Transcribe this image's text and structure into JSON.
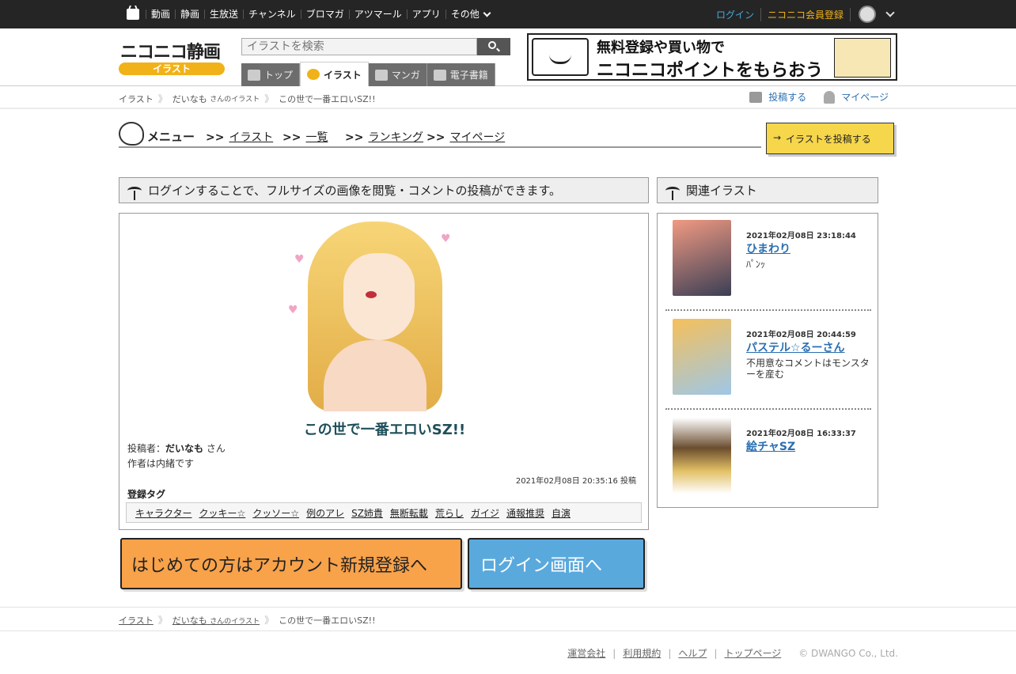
{
  "topbar": {
    "nav": [
      "動画",
      "静画",
      "生放送",
      "チャンネル",
      "ブロマガ",
      "アツマール",
      "アプリ"
    ],
    "more": "その他",
    "login": "ログイン",
    "register": "ニコニコ会員登録"
  },
  "header": {
    "logo_main": "ニコニコ静画",
    "logo_sub": "イラスト",
    "search_placeholder": "イラストを検索",
    "tabs": [
      "トップ",
      "イラスト",
      "マンガ",
      "電子書籍"
    ],
    "banner_line1": "無料登録や買い物で",
    "banner_line2": "ニコニコポイントをもらおう"
  },
  "breadcrumb": {
    "root": "イラスト",
    "user": "だいなも",
    "user_suffix": "さんのイラスト",
    "current": "この世で一番エロいSZ!!"
  },
  "actions": {
    "post": "投稿する",
    "mypage": "マイページ"
  },
  "menu": {
    "title": "メニュー",
    "prefix": ">>",
    "links": [
      "イラスト",
      "一覧",
      "ランキング",
      "マイページ"
    ],
    "post_button": "イラストを投稿する"
  },
  "main": {
    "notice": "ログインすることで、フルサイズの画像を閲覧・コメントの投稿ができます。",
    "title": "この世で一番エロいSZ!!",
    "poster_label": "投稿者：",
    "poster_name": "だいなも",
    "poster_suffix": "さん",
    "author_note": "作者は内緒です",
    "posted_at": "2021年02月08日 20:35:16 投稿",
    "tags_label": "登録タグ",
    "tags": [
      "キャラクター",
      "クッキー☆",
      "クッソー☆",
      "例のアレ",
      "SZ姉貴",
      "無断転載",
      "荒らし",
      "ガイジ",
      "通報推奨",
      "自演"
    ],
    "register_button": "はじめての方はアカウント新規登録へ",
    "login_button": "ログイン画面へ"
  },
  "related": {
    "title": "関連イラスト",
    "items": [
      {
        "date": "2021年02月08日 23:18:44",
        "name": "ひまわり",
        "desc": "ﾊﾟﾝｯ"
      },
      {
        "date": "2021年02月08日 20:44:59",
        "name": "パステル☆るーさん",
        "desc": "不用意なコメントはモンスターを産む"
      },
      {
        "date": "2021年02月08日 16:33:37",
        "name": "絵チャSZ",
        "desc": ""
      }
    ]
  },
  "footer": {
    "links": [
      "運営会社",
      "利用規約",
      "ヘルプ",
      "トップページ"
    ],
    "copyright": "© DWANGO Co., Ltd."
  }
}
